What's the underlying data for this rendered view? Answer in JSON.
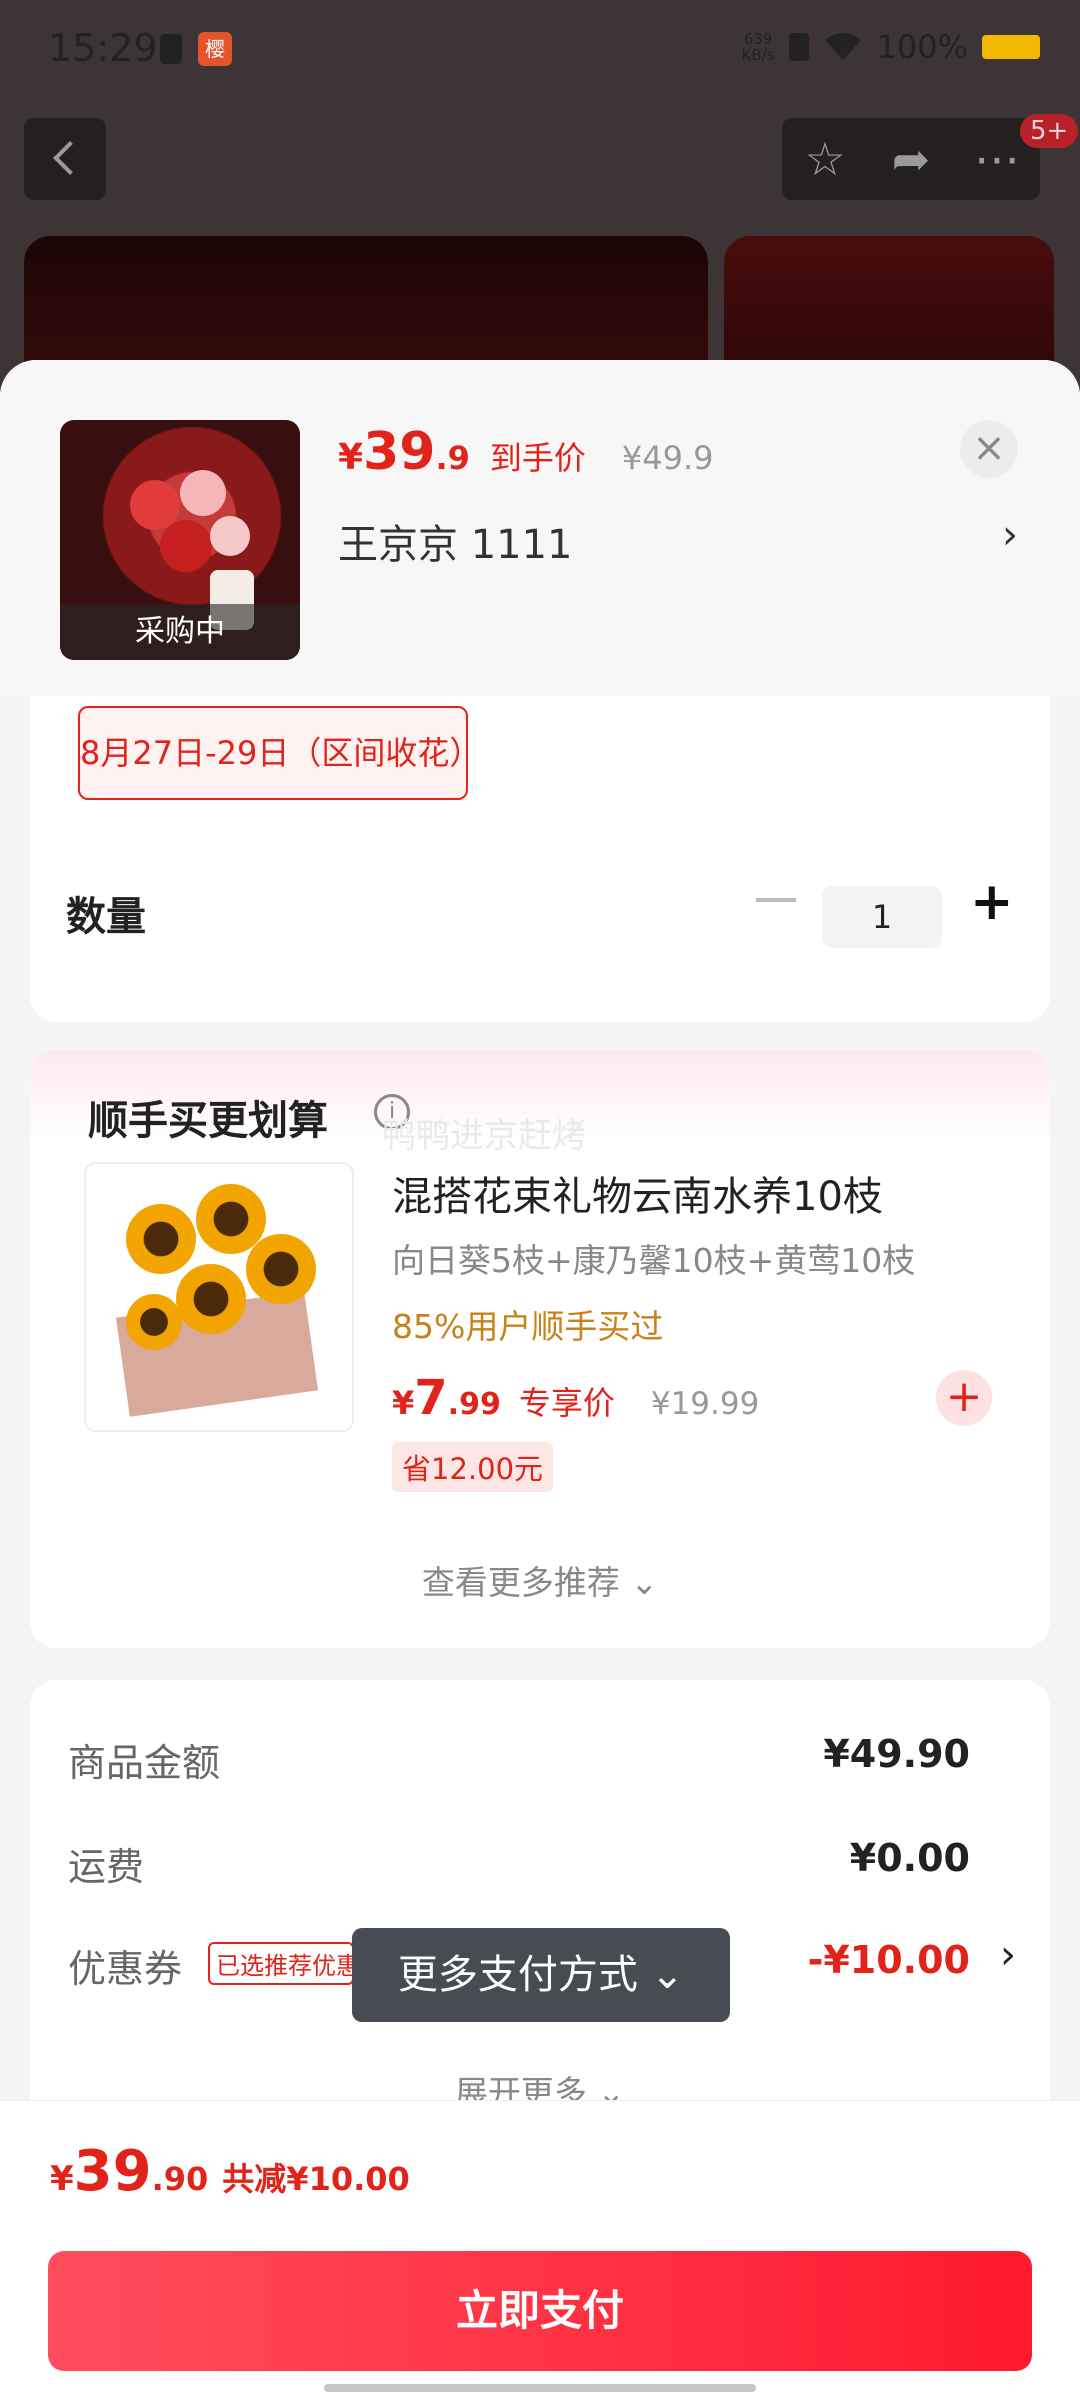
{
  "status_bar": {
    "time": "15:29",
    "net_speed_value": "639",
    "net_speed_unit": "KB/s",
    "battery_pct": "100%",
    "app_badge": "樱"
  },
  "background_page": {
    "notification_badge": "5+"
  },
  "product": {
    "price_yen": "¥",
    "price_int": "39",
    "price_dec": ".9",
    "price_label": "到手价",
    "orig_price": "¥49.9",
    "spec": "王京京  1111",
    "thumb_label": "采购中"
  },
  "delivery": {
    "date_chip": "8月27日-29日（区间收花）"
  },
  "quantity": {
    "label": "数量",
    "value": "1",
    "minus": "−",
    "plus": "+"
  },
  "recommend": {
    "title": "顺手买更划算",
    "watermark": "鸭鸭进京赶烤",
    "item_name": "混搭花束礼物云南水养10枝",
    "item_desc": "向日葵5枝+康乃馨10枝+黄莺10枝",
    "item_sold": "85%用户顺手买过",
    "price_yen": "¥",
    "price_int": "7",
    "price_dec": ".99",
    "price_label": "专享价",
    "orig_price": "¥19.99",
    "save_text": "省12.00元",
    "more": "查看更多推荐 ⌄"
  },
  "fees": {
    "goods_label": "商品金额",
    "goods_value": "¥49.90",
    "shipping_label": "运费",
    "shipping_value": "¥0.00",
    "coupon_label": "优惠券",
    "coupon_tag": "已选推荐优惠",
    "coupon_value": "-¥10.00",
    "expand": "展开更多 ⌄"
  },
  "tooltip": {
    "text": "更多支付方式 ⌄"
  },
  "bottom": {
    "total_yen": "¥",
    "total_int": "39",
    "total_dec": ".90",
    "total_cut": "共减¥10.00",
    "pay_button": "立即支付"
  },
  "colors": {
    "accent": "#e2231a",
    "pay_gradient_start": "#ff4d5e",
    "pay_gradient_end": "#ff1a2d"
  }
}
